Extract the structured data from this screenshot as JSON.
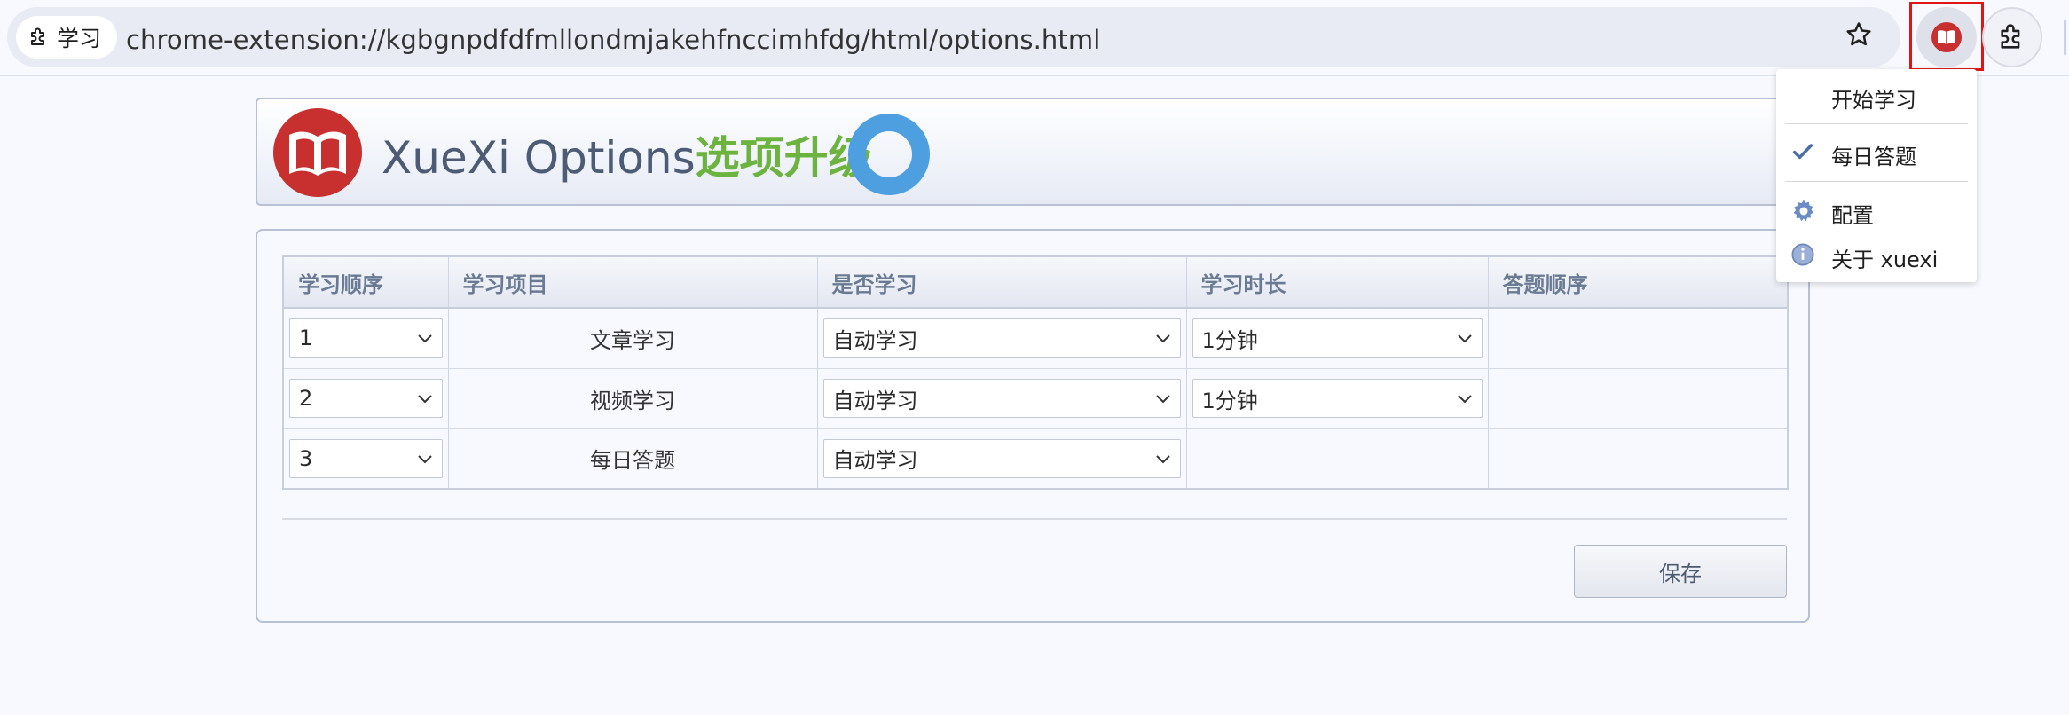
{
  "browser": {
    "site_chip_label": "学习",
    "url": "chrome-extension://kgbgnpdfdfmllondmjakehfnccimhfdg/html/options.html"
  },
  "header": {
    "title_main": "XueXi Options",
    "title_accent": "选项升级"
  },
  "table": {
    "headers": [
      "学习顺序",
      "学习项目",
      "是否学习",
      "学习时长",
      "答题顺序"
    ],
    "rows": [
      {
        "order": "1",
        "item": "文章学习",
        "learn": "自动学习",
        "duration": "1分钟"
      },
      {
        "order": "2",
        "item": "视频学习",
        "learn": "自动学习",
        "duration": "1分钟"
      },
      {
        "order": "3",
        "item": "每日答题",
        "learn": "自动学习"
      }
    ]
  },
  "save_label": "保存",
  "menu": {
    "items": [
      "开始学习",
      "每日答题",
      "配置",
      "关于 xuexi"
    ]
  },
  "colors": {
    "accent_green": "#6db33f",
    "logo_red": "#c8302f",
    "ring_blue": "#4d9fe0",
    "highlight_red": "#e01616"
  }
}
